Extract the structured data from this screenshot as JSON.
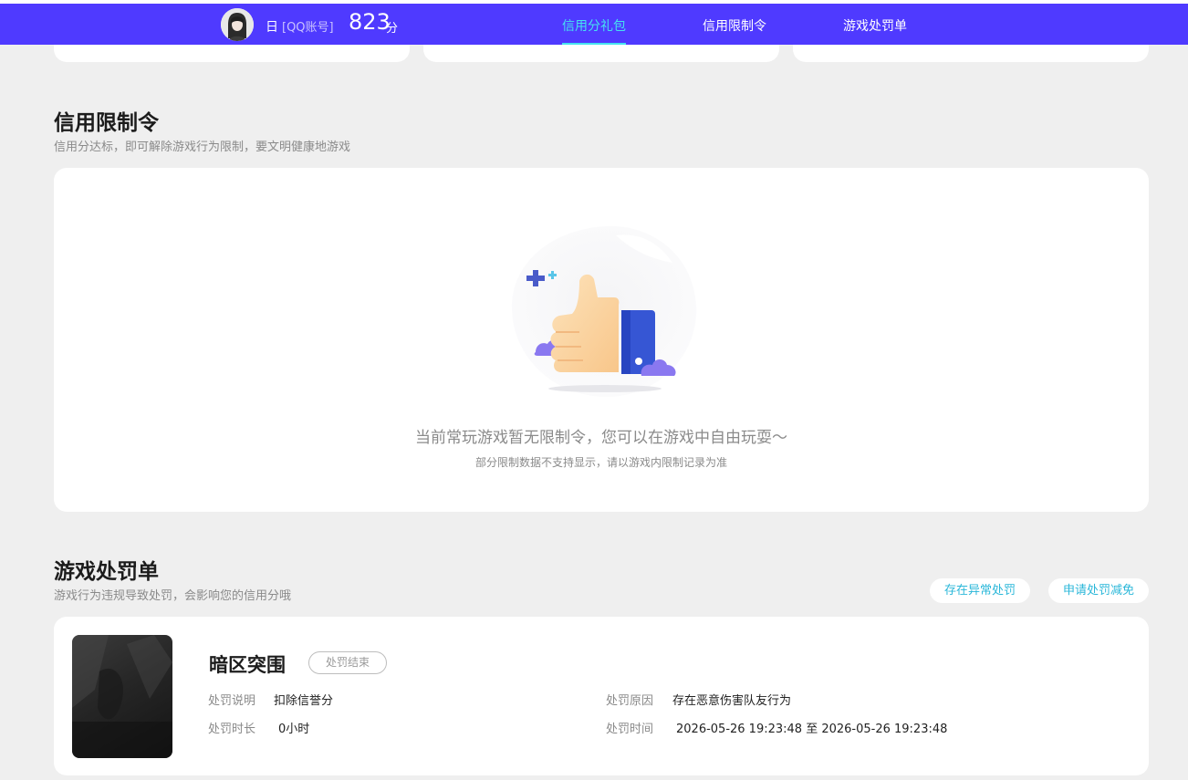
{
  "header": {
    "user_name": "日",
    "account_label": "[QQ账号]",
    "score": "823",
    "score_unit": "分",
    "nav": [
      {
        "label": "信用分礼包",
        "active": true
      },
      {
        "label": "信用限制令",
        "active": false
      },
      {
        "label": "游戏处罚单",
        "active": false
      }
    ]
  },
  "restriction": {
    "title": "信用限制令",
    "subtitle": "信用分达标，即可解除游戏行为限制，要文明健康地游戏",
    "empty_title": "当前常玩游戏暂无限制令，您可以在游戏中自由玩耍～",
    "empty_note": "部分限制数据不支持显示，请以游戏内限制记录为准"
  },
  "penalty": {
    "title": "游戏处罚单",
    "subtitle": "游戏行为违规导致处罚，会影响您的信用分哦",
    "buttons": {
      "abnormal": "存在异常处罚",
      "appeal": "申请处罚减免"
    },
    "record": {
      "game_name": "暗区突围",
      "status": "处罚结束",
      "desc_label": "处罚说明",
      "desc_value": "扣除信誉分",
      "duration_label": "处罚时长",
      "duration_value": "0小时",
      "reason_label": "处罚原因",
      "reason_value": "存在恶意伤害队友行为",
      "time_label": "处罚时间",
      "time_value": "2026-05-26 19:23:48 至 2026-05-26 19:23:48"
    }
  },
  "colors": {
    "header_bg": "#4f3aff",
    "accent": "#45e3f0",
    "link": "#2ab7d9",
    "page_bg": "#efefef"
  }
}
